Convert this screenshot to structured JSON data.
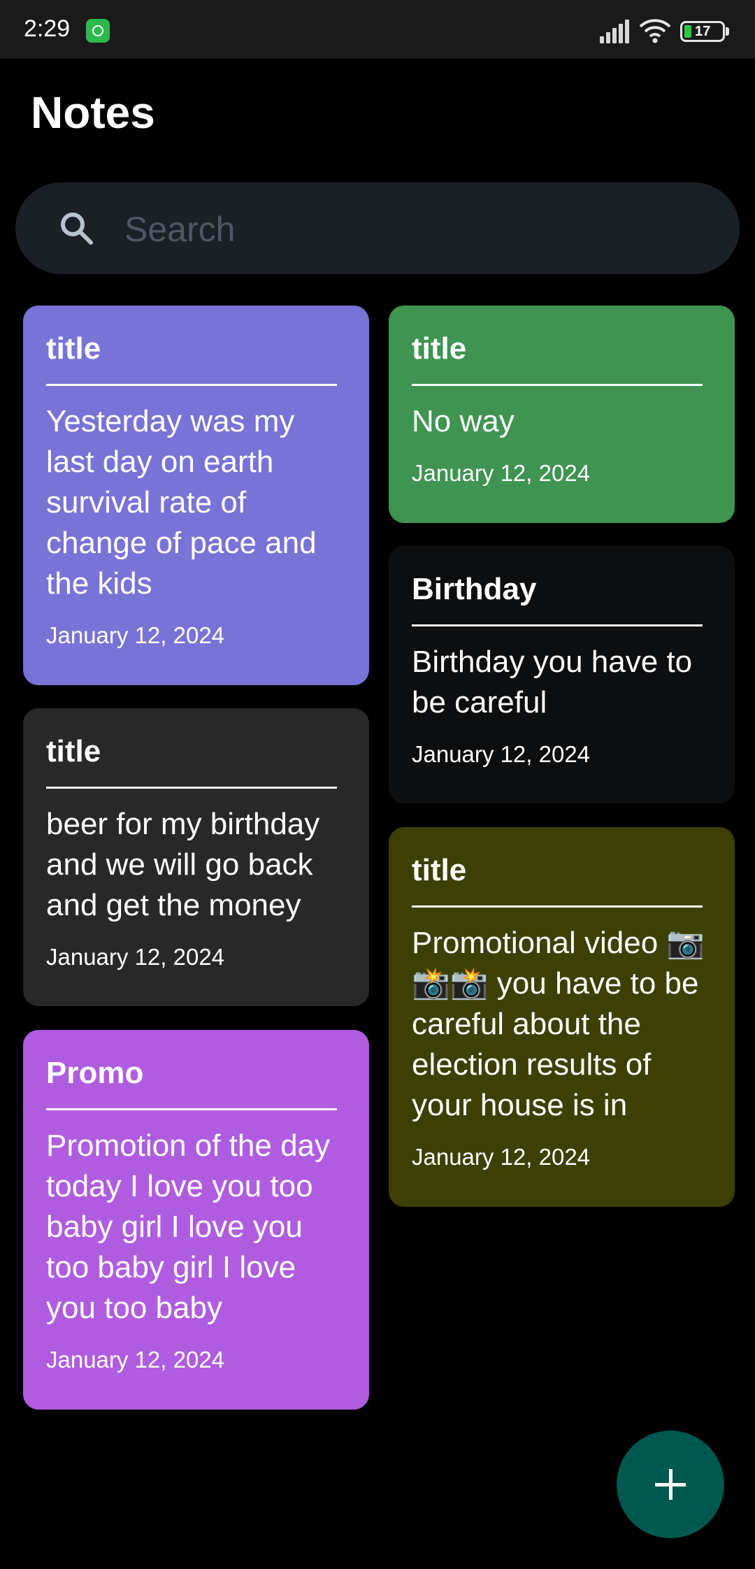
{
  "status_bar": {
    "time": "2:29",
    "battery": "17",
    "app_icon": "android-robot-icon",
    "icons": [
      "signal-icon",
      "wifi-icon",
      "battery-icon"
    ]
  },
  "header": {
    "title": "Notes"
  },
  "search": {
    "placeholder": "Search",
    "value": ""
  },
  "notes": [
    {
      "title": "title",
      "body": "Yesterday was my last day on earth survival rate of change of pace and the kids",
      "date": "January 12, 2024",
      "color": "#7873d6"
    },
    {
      "title": "title",
      "body": "No way",
      "date": "January 12, 2024",
      "color": "#3e9450"
    },
    {
      "title": "Birthday",
      "body": "Birthday you have to be careful",
      "date": "January 12, 2024",
      "color": "#0d0e10"
    },
    {
      "title": "title",
      "body": "beer for my birthday and we will go back and get the money",
      "date": "January 12, 2024",
      "color": "#282828"
    },
    {
      "title": "title",
      "body": "Promotional video 📷📸📸 you have to be careful about the election results of your house is in",
      "date": "January 12, 2024",
      "color": "#3d4003"
    },
    {
      "title": "Promo",
      "body": "Promotion of the day today I love you too baby girl I love you too baby girl I love you too baby",
      "date": "January 12, 2024",
      "color": "#b05ce0"
    }
  ],
  "fab": {
    "icon": "plus-icon",
    "color": "#00584f"
  }
}
